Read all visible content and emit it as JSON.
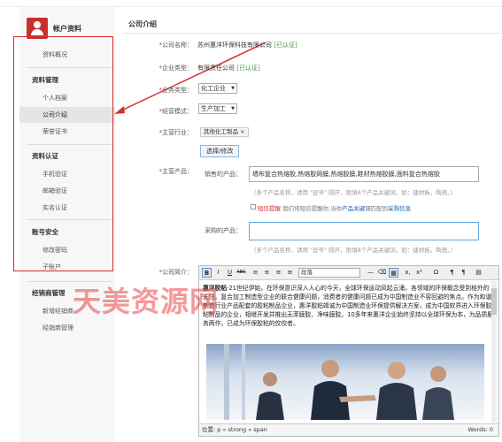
{
  "sidebar": {
    "title": "帐户资料",
    "groups": [
      {
        "label": "资料管理"
      },
      {
        "label": "资料认证"
      },
      {
        "label": "账号安全"
      },
      {
        "label": "经销商管理"
      }
    ],
    "items": [
      {
        "label": "资料概况"
      },
      {
        "label": "个人档案"
      },
      {
        "label": "公司介绍"
      },
      {
        "label": "荣誉证书"
      },
      {
        "label": "手机验证"
      },
      {
        "label": "邮箱验证"
      },
      {
        "label": "实名认证"
      },
      {
        "label": "修改密码"
      },
      {
        "label": "子账户"
      },
      {
        "label": "新增经销商"
      },
      {
        "label": "经销商管理"
      }
    ]
  },
  "main": {
    "title": "公司介绍",
    "company_name_label": "公司名称：",
    "company_name": "苏州惠洋环保科技有限公司",
    "company_name_status": "[已认证]",
    "enterprise_type_label": "企业类型：",
    "enterprise_type": "有限责任公司",
    "enterprise_type_status": "[已认证]",
    "business_type_label": "业务类型：",
    "business_type": "化工企业",
    "business_mode_label": "经营模式：",
    "business_mode": "生产加工",
    "industry_label": "主营行业：",
    "industry_tag": "其他化工制品 ×",
    "select_button": "选择/修改",
    "products_label": "主营产品：",
    "sell_label": "销售的产品：",
    "sell_value": "墙布复合热熔胶,热熔胶网膜,热熔胶膜,鞋材热熔胶膜,面料复合热熔胶",
    "sell_hint": "（多个产品名称，请用 \"逗号\" 隔开，限填8个产品关键词，如：建材板，陶瓷。）",
    "sms_label": "短信提醒",
    "sms_text": "我们将短信提醒你,当你",
    "sms_link1": "产品关键词",
    "sms_mid": "匹配到",
    "sms_link2": "采购信息",
    "buy_label": "采购的产品：",
    "buy_hint": "（多个产品名称，请用 \"逗号\" 隔开，限填8个产品关键词，如：建材板，陶瓷。）",
    "intro_label": "公司简介："
  },
  "editor": {
    "tb_bold": "B",
    "tb_italic": "I",
    "tb_underline": "U",
    "tb_strike": "ABC",
    "tb_format": "段落",
    "tb_sub": "x,",
    "tb_sup": "x²",
    "tb_omega": "Ω",
    "content_bold": "惠洋胶粘",
    "content": "·21世纪伊始，在环保意识深入人心的今天，全球环保运动风起云涌，各领域的环保概念受到格外的关注。复合加工制造型企业的联合健康问题，消费者的健康问题已成为中国制造业不容回避的焦点。作为和谐制造行业产品配套的胶粘制品企业，惠洋胶粘竭诚为中国制造业环保提供解决方案，成为中国软界进入环保胶粘制品的企业，相继开发并推出无苯膜胶、净味膜胶。10多年来惠洋企业始终坚持以全球环保为本，为品质服务两作，已成为环保胶粘的佼佼者。",
    "status_path": "位置: p » strong » span",
    "status_words": "Words: 0"
  },
  "watermark": "天美资源网",
  "colors": {
    "accent_red": "#d32f2f",
    "verified_green": "#3c9a3c",
    "link_blue": "#1a5fb4"
  }
}
